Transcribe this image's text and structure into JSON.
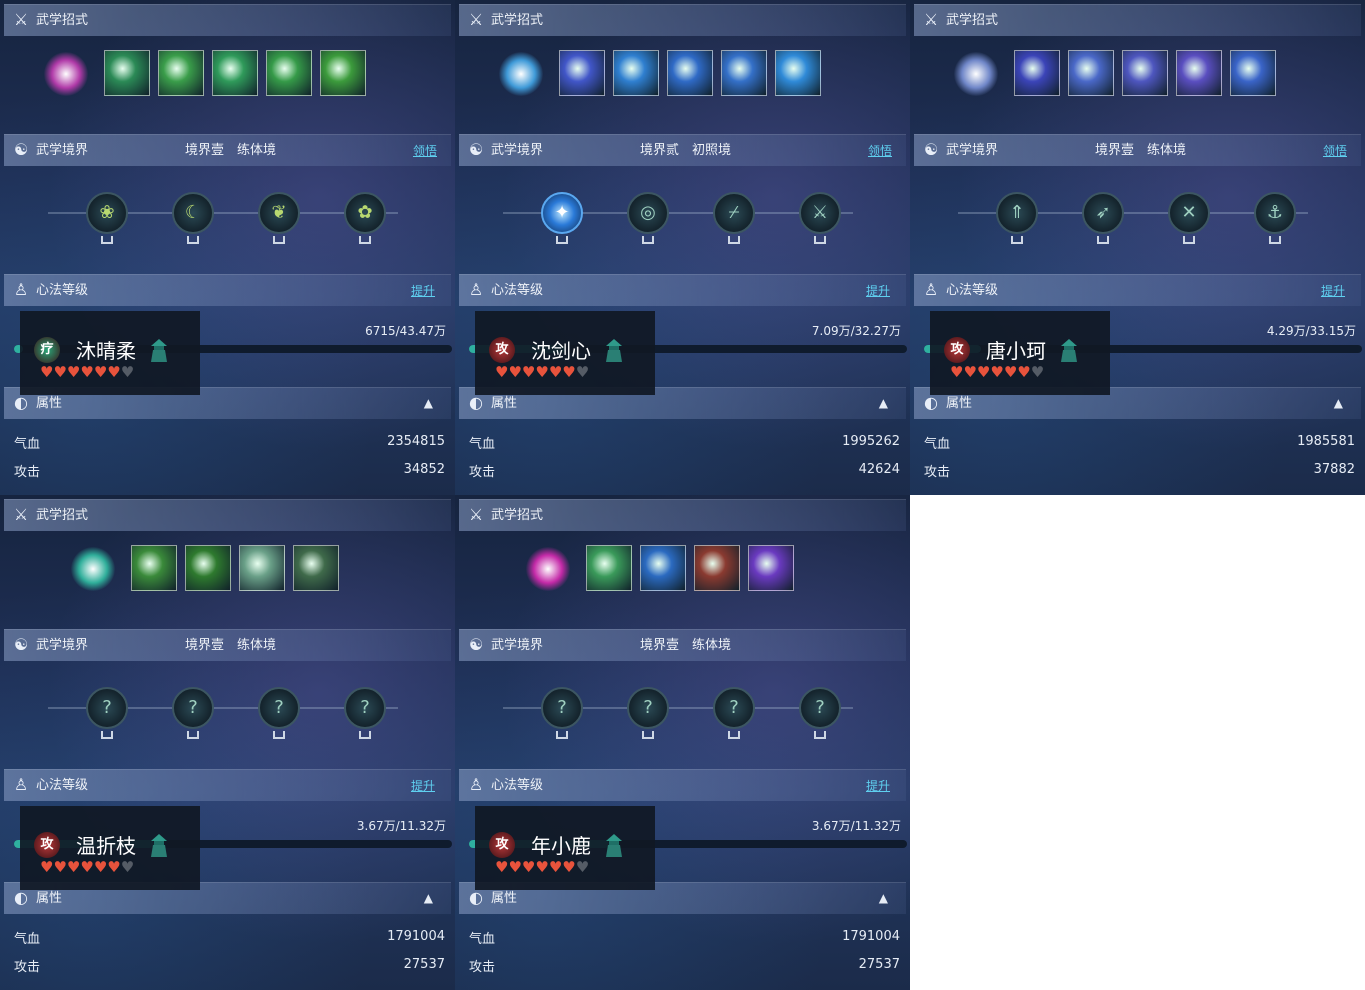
{
  "labels": {
    "skills_title": "武学招式",
    "realm_title": "武学境界",
    "realm_link": "领悟",
    "xinfa_title": "心法等级",
    "xinfa_link": "提升",
    "attr_title": "属性",
    "hp_label": "气血",
    "atk_label": "攻击"
  },
  "icons": {
    "skills_bar": "sword-icon",
    "realm_bar": "swirl-icon",
    "xinfa_bar": "meditating-figure-icon",
    "attr_bar": "orb-icon",
    "collapse": "chevron-up-icon"
  },
  "panels": [
    {
      "realm": "境界壹　练体境",
      "show_realm_link": true,
      "exp": "6715/43.47万",
      "exp_fraction": 0.02,
      "name": "沐晴柔",
      "role": "疗",
      "role_color": "#2aa87a",
      "hearts_filled": 6,
      "hearts_total": 7,
      "hp": "2354815",
      "atk": "34852",
      "main_color": "#b03aa8",
      "skill_colors": [
        "#2b8a56",
        "#3a9d4a",
        "#2f9a5a",
        "#359a48",
        "#3c9b3c"
      ],
      "node_glyphs": [
        "❀",
        "☾",
        "❦",
        "✿"
      ],
      "realm_unlocked": true
    },
    {
      "realm": "境界贰　初照境",
      "show_realm_link": true,
      "exp": "7.09万/32.27万",
      "exp_fraction": 0.22,
      "name": "沈剑心",
      "role": "攻",
      "role_color": "#b8383a",
      "hearts_filled": 6,
      "hearts_total": 7,
      "hp": "1995262",
      "atk": "42624",
      "main_color": "#3f9ad8",
      "skill_colors": [
        "#4156c8",
        "#2f7fd0",
        "#2f6ac6",
        "#3470c8",
        "#2f8ad8"
      ],
      "node_glyphs": [
        "✦",
        "◎",
        "⌿",
        "⚔"
      ],
      "realm_unlocked": true
    },
    {
      "realm": "境界壹　练体境",
      "show_realm_link": true,
      "exp": "4.29万/33.15万",
      "exp_fraction": 0.13,
      "name": "唐小珂",
      "role": "攻",
      "role_color": "#b8383a",
      "hearts_filled": 6,
      "hearts_total": 7,
      "hp": "1985581",
      "atk": "37882",
      "main_color": "#6f86c8",
      "skill_colors": [
        "#3b44b8",
        "#4a68c8",
        "#4e56bf",
        "#5a4ec0",
        "#3a64c8"
      ],
      "node_glyphs": [
        "⇑",
        "➶",
        "✕",
        "⚓"
      ],
      "realm_unlocked": true
    },
    {
      "realm": "境界壹　练体境",
      "show_realm_link": false,
      "exp": "3.67万/11.32万",
      "exp_fraction": 0.32,
      "name": "温折枝",
      "role": "攻",
      "role_color": "#b8383a",
      "hearts_filled": 6,
      "hearts_total": 7,
      "hp": "1791004",
      "atk": "27537",
      "main_color": "#2fae9a",
      "skill_colors": [
        "#3a8a3a",
        "#2e7a2e",
        "#6aa088",
        "#3f6a4a"
      ],
      "node_glyphs": [
        "?",
        "?",
        "?",
        "?"
      ],
      "realm_unlocked": false
    },
    {
      "realm": "境界壹　练体境",
      "show_realm_link": false,
      "exp": "3.67万/11.32万",
      "exp_fraction": 0.32,
      "name": "年小鹿",
      "role": "攻",
      "role_color": "#b8383a",
      "hearts_filled": 6,
      "hearts_total": 7,
      "hp": "1791004",
      "atk": "27537",
      "main_color": "#c42aa8",
      "skill_colors": [
        "#3a9a5a",
        "#2b6ac0",
        "#8a3a30",
        "#6a3ac0"
      ],
      "node_glyphs": [
        "?",
        "?",
        "?",
        "?"
      ],
      "realm_unlocked": false
    }
  ]
}
